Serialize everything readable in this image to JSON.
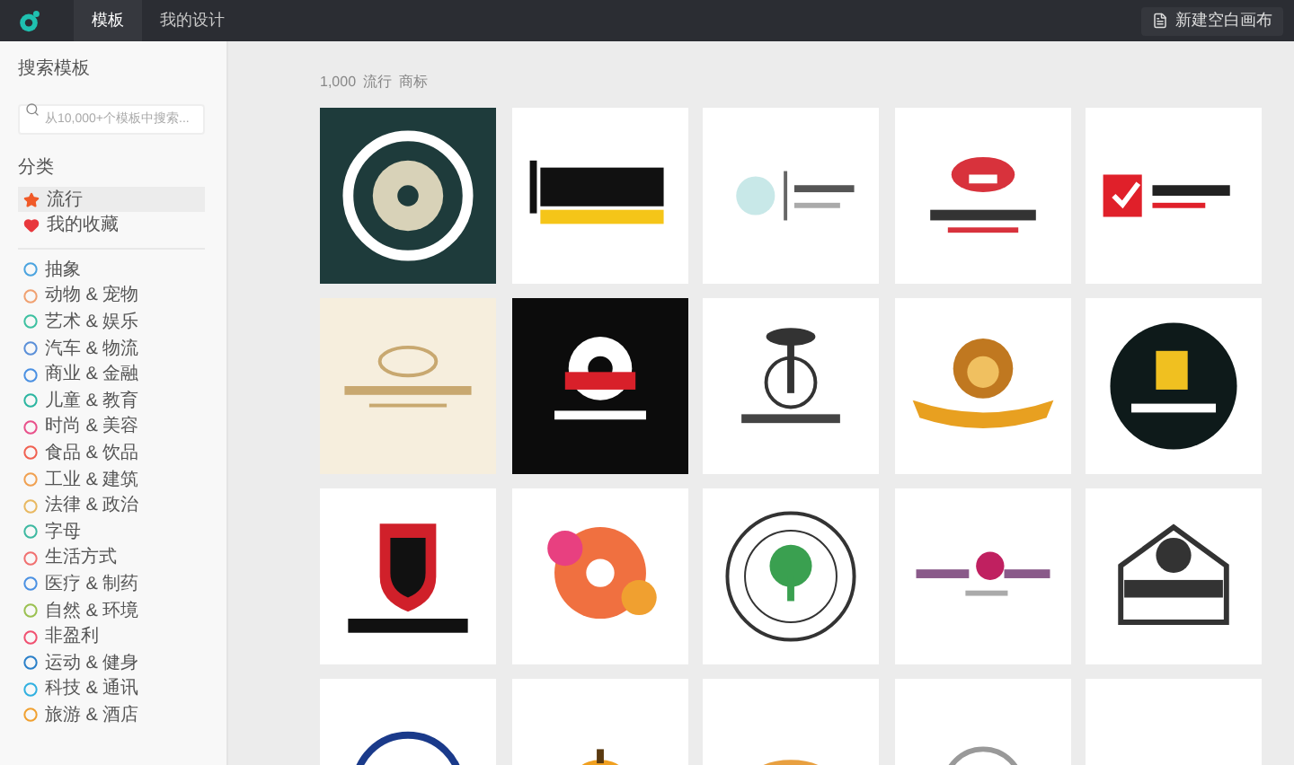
{
  "header": {
    "tabs": [
      {
        "label": "模板",
        "selected": true
      },
      {
        "label": "我的设计",
        "selected": false
      }
    ],
    "new_button": "新建空白画布"
  },
  "sidebar": {
    "search_title": "搜索模板",
    "search": {
      "placeholder": "从10,000+个模板中搜索..."
    },
    "category_title": "分类",
    "top_items": [
      {
        "label": "流行",
        "selected": true,
        "color": "#f05a28"
      },
      {
        "label": "我的收藏",
        "selected": false,
        "color": "#e8383d"
      }
    ],
    "items": [
      {
        "label": "抽象",
        "color": "#4aa3df"
      },
      {
        "label": "动物 & 宠物",
        "color": "#f0a070"
      },
      {
        "label": "艺术 & 娱乐",
        "color": "#3cc0a0"
      },
      {
        "label": "汽车 & 物流",
        "color": "#5a8fd8"
      },
      {
        "label": "商业 & 金融",
        "color": "#4a90e2"
      },
      {
        "label": "儿童 & 教育",
        "color": "#2bb5a0"
      },
      {
        "label": "时尚 & 美容",
        "color": "#e8508a"
      },
      {
        "label": "食品 & 饮品",
        "color": "#f06050"
      },
      {
        "label": "工业 & 建筑",
        "color": "#f0a050"
      },
      {
        "label": "法律 & 政治",
        "color": "#e8b860"
      },
      {
        "label": "字母",
        "color": "#3cb8a0"
      },
      {
        "label": "生活方式",
        "color": "#f07070"
      },
      {
        "label": "医疗 & 制药",
        "color": "#4a90e2"
      },
      {
        "label": "自然 & 环境",
        "color": "#9ac050"
      },
      {
        "label": "非盈利",
        "color": "#f05070"
      },
      {
        "label": "运动 & 健身",
        "color": "#2a7fc8"
      },
      {
        "label": "科技 & 通讯",
        "color": "#30b0e0"
      },
      {
        "label": "旅游 & 酒店",
        "color": "#f0a030"
      }
    ]
  },
  "main": {
    "count": "1,000",
    "category": "流行",
    "unit": "商标",
    "tiles": [
      {
        "kind": "disc"
      },
      {
        "kind": "bars"
      },
      {
        "kind": "script"
      },
      {
        "kind": "lips"
      },
      {
        "kind": "bag"
      },
      {
        "kind": "ornament"
      },
      {
        "kind": "vinyl"
      },
      {
        "kind": "palm"
      },
      {
        "kind": "lion"
      },
      {
        "kind": "mug"
      },
      {
        "kind": "shield"
      },
      {
        "kind": "splash"
      },
      {
        "kind": "tree"
      },
      {
        "kind": "flower"
      },
      {
        "kind": "ball"
      },
      {
        "kind": "seal"
      },
      {
        "kind": "pumpkin"
      },
      {
        "kind": "burger"
      },
      {
        "kind": "monogram"
      },
      {
        "kind": "plain"
      }
    ]
  }
}
